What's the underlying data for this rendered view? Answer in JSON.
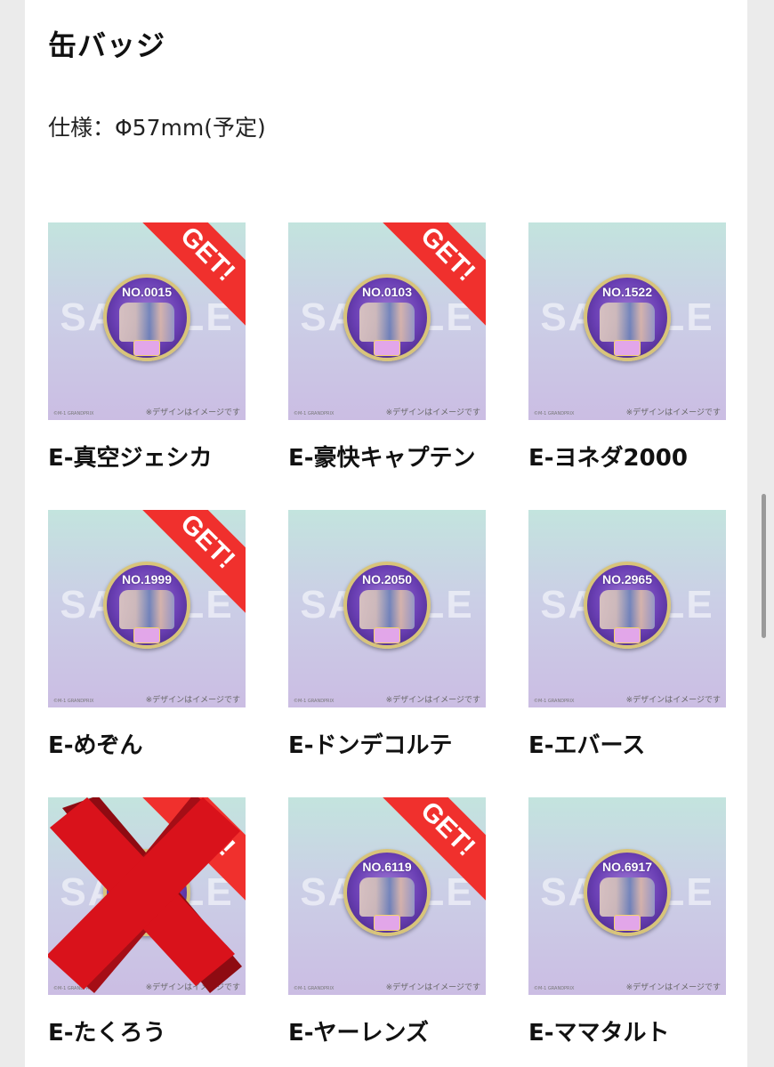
{
  "page": {
    "title": "缶バッジ",
    "spec": "仕様：Φ57mm(予定)"
  },
  "thumb": {
    "watermark": "SAMPLE",
    "note": "※デザインはイメージです",
    "credit": "©M-1 GRANDPRIX",
    "get_label": "GET!"
  },
  "items": [
    {
      "name": "E-真空ジェシカ",
      "badge_no": "NO.0015",
      "got": true,
      "crossed": false
    },
    {
      "name": "E-豪快キャプテン",
      "badge_no": "NO.0103",
      "got": true,
      "crossed": false
    },
    {
      "name": "E-ヨネダ2000",
      "badge_no": "NO.1522",
      "got": false,
      "crossed": false
    },
    {
      "name": "E-めぞん",
      "badge_no": "NO.1999",
      "got": true,
      "crossed": false
    },
    {
      "name": "E-ドンデコルテ",
      "badge_no": "NO.2050",
      "got": false,
      "crossed": false
    },
    {
      "name": "E-エバース",
      "badge_no": "NO.2965",
      "got": false,
      "crossed": false
    },
    {
      "name": "E-たくろう",
      "badge_no": "",
      "got": true,
      "crossed": true
    },
    {
      "name": "E-ヤーレンズ",
      "badge_no": "NO.6119",
      "got": true,
      "crossed": false
    },
    {
      "name": "E-ママタルト",
      "badge_no": "NO.6917",
      "got": false,
      "crossed": false
    }
  ],
  "colors": {
    "get_ribbon": "#f0302d",
    "cross_mark": "#d9121b"
  }
}
